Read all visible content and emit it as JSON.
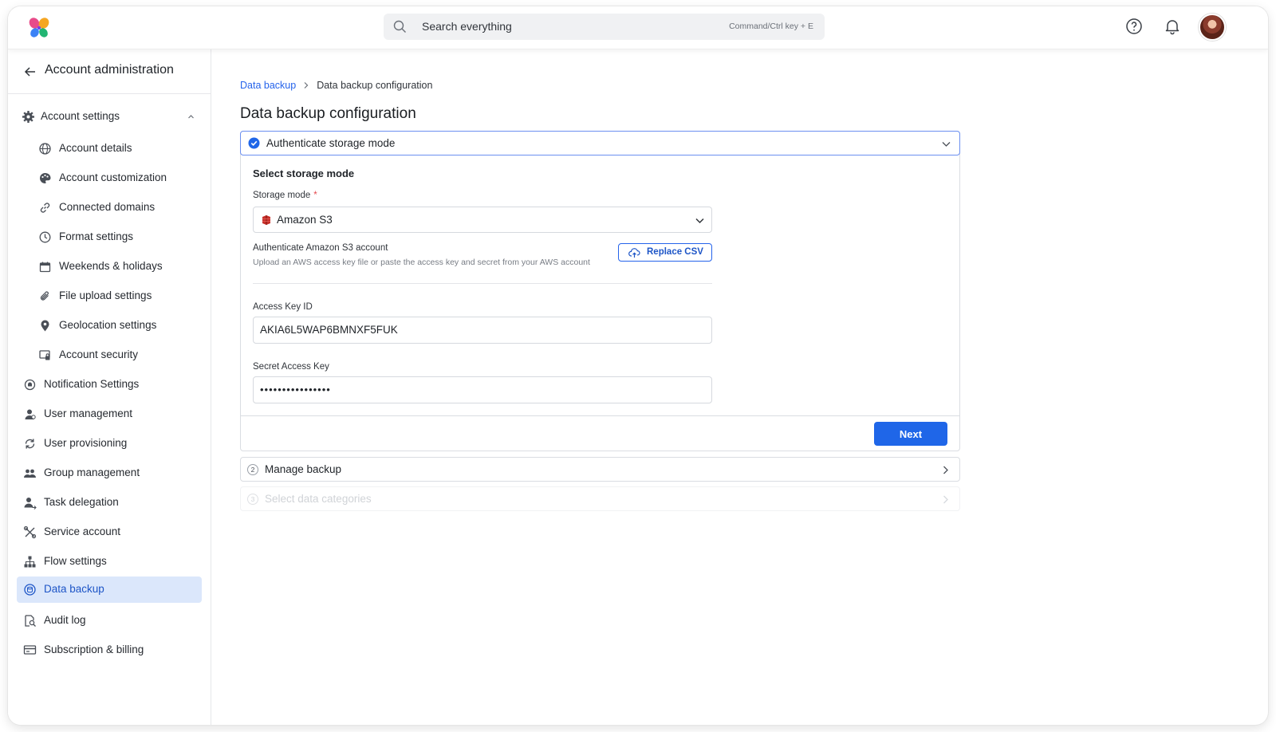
{
  "topbar": {
    "search_placeholder": "Search everything",
    "search_hint": "Command/Ctrl key + E",
    "icons": [
      "help-icon",
      "bell-icon"
    ]
  },
  "sidebar": {
    "title": "Account administration",
    "section": "Account settings",
    "sub_items": [
      {
        "label": "Account details",
        "icon": "globe-icon"
      },
      {
        "label": "Account customization",
        "icon": "palette-icon"
      },
      {
        "label": "Connected domains",
        "icon": "link-icon"
      },
      {
        "label": "Format settings",
        "icon": "clock-icon"
      },
      {
        "label": "Weekends & holidays",
        "icon": "calendar-icon"
      },
      {
        "label": "File upload settings",
        "icon": "paperclip-icon"
      },
      {
        "label": "Geolocation settings",
        "icon": "location-pin-icon"
      },
      {
        "label": "Account security",
        "icon": "lock-screen-icon"
      }
    ],
    "items": [
      {
        "label": "Notification Settings",
        "icon": "notification-icon"
      },
      {
        "label": "User management",
        "icon": "user-icon"
      },
      {
        "label": "User provisioning",
        "icon": "sync-icon"
      },
      {
        "label": "Group management",
        "icon": "group-icon"
      },
      {
        "label": "Task delegation",
        "icon": "delegate-icon"
      },
      {
        "label": "Service account",
        "icon": "tools-icon"
      },
      {
        "label": "Flow settings",
        "icon": "hierarchy-icon"
      },
      {
        "label": "Data backup",
        "icon": "backup-icon",
        "active": true
      },
      {
        "label": "Audit log",
        "icon": "audit-icon"
      },
      {
        "label": "Subscription & billing",
        "icon": "billing-icon"
      }
    ]
  },
  "breadcrumb": {
    "parent": "Data backup",
    "current": "Data backup configuration"
  },
  "page_title": "Data backup configuration",
  "step1": {
    "label": "Authenticate storage mode",
    "section_title": "Select storage mode",
    "storage_mode_label": "Storage mode",
    "required_mark": "*",
    "storage_mode_value": "Amazon S3",
    "auth_title": "Authenticate Amazon S3 account",
    "auth_desc": "Upload an AWS access key file or paste the access key and secret from your AWS account",
    "replace_button": "Replace CSV",
    "access_key_label": "Access Key ID",
    "access_key_value": "AKIA6L5WAP6BMNXF5FUK",
    "secret_key_label": "Secret Access Key",
    "secret_key_value": "••••••••••••••••",
    "next_button": "Next"
  },
  "step2": {
    "number": "2",
    "label": "Manage backup"
  },
  "step3": {
    "number": "3",
    "label": "Select data categories"
  },
  "colors": {
    "accent": "#1f66e8",
    "active_bg": "#dbe7fb",
    "link": "#2563eb"
  }
}
